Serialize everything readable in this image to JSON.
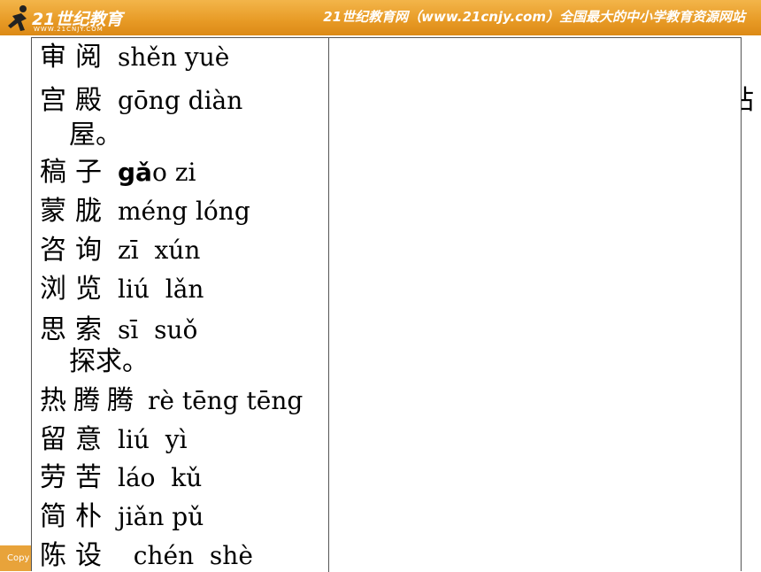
{
  "header": {
    "logo_text": "21世纪教育",
    "logo_sub": "WWW.21CNJY.COM",
    "slogan": "21世纪教育网（www.21cnjy.com）全国最大的中小学教育资源网站"
  },
  "footer": {
    "copyright": "Copy"
  },
  "side_fragment": "站",
  "vocab": [
    {
      "chars": "审阅",
      "pinyin": "shěn yuè"
    },
    {
      "chars": "宫殿",
      "pinyin": "gōng diàn",
      "continuation": "屋。"
    },
    {
      "chars": "稿子",
      "pinyin_bold": "gǎ",
      "pinyin": "o zi"
    },
    {
      "chars": "蒙胧",
      "pinyin": "méng lóng"
    },
    {
      "chars": "咨询",
      "pinyin": "zī  xún"
    },
    {
      "chars": "浏览",
      "pinyin": "liú  lǎn"
    },
    {
      "chars": "思索",
      "pinyin": "sī  suǒ",
      "continuation": "探求。"
    },
    {
      "chars": "热腾腾",
      "pinyin": "rè tēng tēng"
    },
    {
      "chars": "留意",
      "pinyin": "liú  yì"
    },
    {
      "chars": "劳苦",
      "pinyin": "láo  kǔ"
    },
    {
      "chars": "简朴",
      "pinyin": "jiǎn pǔ"
    },
    {
      "chars": "陈设",
      "pinyin": "  chén  shè"
    }
  ]
}
